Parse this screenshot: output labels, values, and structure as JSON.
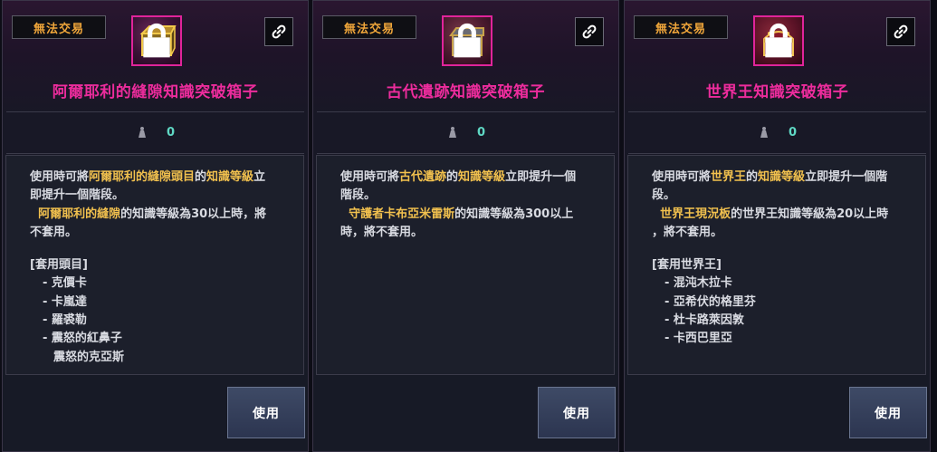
{
  "panels": [
    {
      "trade_label": "無法交易",
      "icon": "treasure-box-icon",
      "item_name": "阿爾耶利的縫隙知識突破箱子",
      "stat_value": "0",
      "desc": {
        "l1a": "使用時可將",
        "l1b": "阿爾耶利的縫隙頭目",
        "l1c": "的",
        "l1d": "知識等級",
        "l1e": "立",
        "l2": "即提升一個階段。",
        "l3a": "阿爾耶利的縫隙",
        "l3b": "的知識等級為30以上時，將",
        "l4": "不套用。",
        "list_header": "[套用頭目]",
        "list": [
          "- 克價卡",
          "- 卡嵐達",
          "- 羅裘勒",
          "- 震怒的紅鼻子",
          "震怒的克亞斯"
        ]
      },
      "use_label": "使用"
    },
    {
      "trade_label": "無法交易",
      "icon": "treasure-box-icon",
      "item_name": "古代遺跡知識突破箱子",
      "stat_value": "0",
      "desc": {
        "l1a": "使用時可將",
        "l1b": "古代遺跡",
        "l1c": "的",
        "l1d": "知識等級",
        "l1e": "立即提升一個",
        "l2": "階段。",
        "l3a": "守護者卡布亞米雷斯",
        "l3b": "的知識等級為300以上",
        "l4": "時，將不套用。"
      },
      "use_label": "使用"
    },
    {
      "trade_label": "無法交易",
      "icon": "treasure-box-icon",
      "item_name": "世界王知識突破箱子",
      "stat_value": "0",
      "desc": {
        "l1a": "使用時可將",
        "l1b": "世界王",
        "l1c": "的",
        "l1d": "知識等級",
        "l1e": "立即提升一個階",
        "l2": "段。",
        "l3a": "世界王現況板",
        "l3b": "的世界王知識等級為20以上時",
        "l4": "，將不套用。",
        "list_header": "[套用世界王]",
        "list": [
          "- 混沌木拉卡",
          "- 亞希伏的格里芬",
          "- 杜卡路萊因敦",
          "- 卡西巴里亞"
        ]
      },
      "use_label": "使用"
    }
  ],
  "colors": {
    "item_name": "#ec2c9c",
    "highlight": "#f2c14e",
    "trade_label": "#f0a63a",
    "stat_value": "#5fd8c4"
  }
}
